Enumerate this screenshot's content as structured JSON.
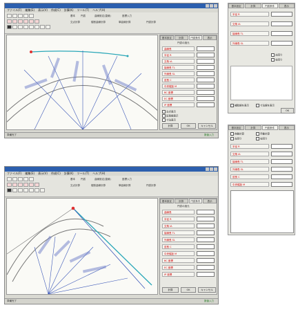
{
  "window1": {
    "title": "",
    "menus": [
      "ファイル(F)",
      "編集(E)",
      "表示(V)",
      "作成(C)",
      "計算(K)",
      "ツール(T)",
      "ヘルプ(H)"
    ],
    "ribbon": [
      "基本",
      "円弧",
      "曲線設定(直線)",
      "座標入力",
      "交点計算",
      "縦断曲線計算",
      "単曲線計算",
      "円弧計算"
    ],
    "panel_tabs": [
      "基本設定",
      "計算",
      "円弧条件",
      "表示"
    ],
    "panel_header": "円弧の諸元",
    "rows": [
      {
        "label": "曲線長",
        "value": ""
      },
      {
        "label": "半径 R",
        "value": ""
      },
      {
        "label": "交角 IA",
        "value": ""
      },
      {
        "label": "接線長 TL",
        "value": ""
      },
      {
        "label": "外線長 SL",
        "value": ""
      },
      {
        "label": "弦長 C",
        "value": ""
      },
      {
        "label": "中央縦距 M",
        "value": ""
      },
      {
        "label": "BC 座標",
        "value": ""
      },
      {
        "label": "EC 座標",
        "value": ""
      },
      {
        "label": "IP 座標",
        "value": ""
      }
    ],
    "checks": [
      "交点表示",
      "延長線表示",
      "寸法表示"
    ],
    "buttons": [
      "計算",
      "OK",
      "キャンセル"
    ],
    "status": "準備完了",
    "status_right": "数値入力"
  },
  "window2": {
    "title": "",
    "menus": [
      "ファイル(F)",
      "編集(E)",
      "表示(V)",
      "作成(C)",
      "計算(K)",
      "ツール(T)",
      "ヘルプ(H)"
    ],
    "ribbon": [
      "基本",
      "円弧",
      "曲線設定(直線)",
      "座標入力",
      "交点計算",
      "縦断曲線計算",
      "単曲線計算",
      "円弧計算"
    ],
    "panel_tabs": [
      "基本設定",
      "計算",
      "円弧条件",
      "表示"
    ],
    "panel_header": "円弧の諸元",
    "rows": [
      {
        "label": "曲線長",
        "value": ""
      },
      {
        "label": "半径 R",
        "value": ""
      },
      {
        "label": "交角 IA",
        "value": ""
      },
      {
        "label": "接線長 TL",
        "value": ""
      },
      {
        "label": "外線長 SL",
        "value": ""
      },
      {
        "label": "弦長 C",
        "value": ""
      },
      {
        "label": "中央縦距 M",
        "value": ""
      },
      {
        "label": "BC 座標",
        "value": ""
      },
      {
        "label": "EC 座標",
        "value": ""
      },
      {
        "label": "IP 座標",
        "value": ""
      }
    ],
    "buttons": [
      "計算",
      "OK",
      "キャンセル"
    ],
    "status": "準備完了",
    "status_right": "数値入力"
  },
  "side1": {
    "tabs": [
      "基本設定",
      "計算",
      "円弧条件",
      "表示"
    ],
    "rows": [
      {
        "label": "半径 R",
        "value": ""
      },
      {
        "label": "交角 IA",
        "value": ""
      },
      {
        "label": "接線長 TL",
        "value": ""
      },
      {
        "label": "外線長 SL",
        "value": ""
      }
    ],
    "checks": [
      "左回り",
      "右回り"
    ],
    "bottom_checks": [
      "補助線を表示",
      "寸法線を表示"
    ],
    "ok": "OK"
  },
  "side2": {
    "tabs": [
      "基本設定",
      "計算",
      "円弧条件",
      "表示"
    ],
    "checks": [
      "自動計算",
      "手動計算",
      "左回り",
      "右回り"
    ],
    "rows": [
      {
        "label": "半径 R",
        "value": ""
      },
      {
        "label": "交角 IA",
        "value": ""
      },
      {
        "label": "接線長 TL",
        "value": ""
      },
      {
        "label": "外線長 SL",
        "value": ""
      },
      {
        "label": "弦長 C",
        "value": ""
      },
      {
        "label": "中央縦距 M",
        "value": ""
      }
    ],
    "notes": ""
  },
  "colors": {
    "accent": "#2c5fae",
    "label_red": "#cc0000",
    "curve_teal": "#2aa7b8",
    "curve_blue": "#3b57b8",
    "point_red": "#e03030"
  }
}
